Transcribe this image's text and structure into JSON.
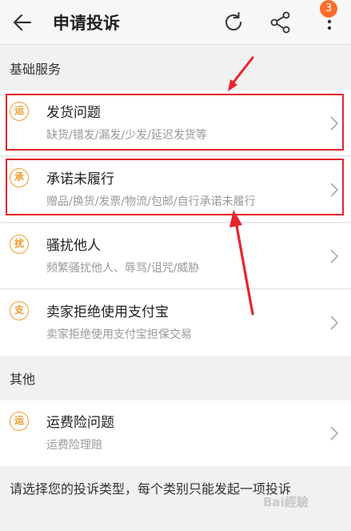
{
  "header": {
    "title": "申请投诉",
    "notification_count": "3"
  },
  "sections": [
    {
      "title": "基础服务",
      "items": [
        {
          "icon_char": "运",
          "title": "发货问题",
          "subtitle": "缺货/错发/漏发/少发/延迟发货等",
          "highlighted": true
        },
        {
          "icon_char": "承",
          "title": "承诺未履行",
          "subtitle": "赠品/换货/发票/物流/包邮/自行承诺未履行",
          "highlighted": true
        },
        {
          "icon_char": "扰",
          "title": "骚扰他人",
          "subtitle": "频繁骚扰他人、辱骂/诅咒/威胁",
          "highlighted": false
        },
        {
          "icon_char": "支",
          "title": "卖家拒绝使用支付宝",
          "subtitle": "卖家拒绝使用支付宝担保交易",
          "highlighted": false
        }
      ]
    },
    {
      "title": "其他",
      "items": [
        {
          "icon_char": "运",
          "title": "运费险问题",
          "subtitle": "运费险理赔",
          "highlighted": false
        }
      ]
    }
  ],
  "footer_note": "请选择您的投诉类型，每个类别只能发起一项投诉",
  "watermark": "Bai經驗",
  "colors": {
    "accent_orange": "#f39a2b",
    "highlight_red": "#e8232a",
    "badge_orange": "#ff6c2c"
  },
  "icons": {
    "back": "arrow-left-icon",
    "refresh": "refresh-icon",
    "share": "share-icon",
    "more": "more-vertical-icon",
    "chevron": "chevron-right-icon"
  }
}
